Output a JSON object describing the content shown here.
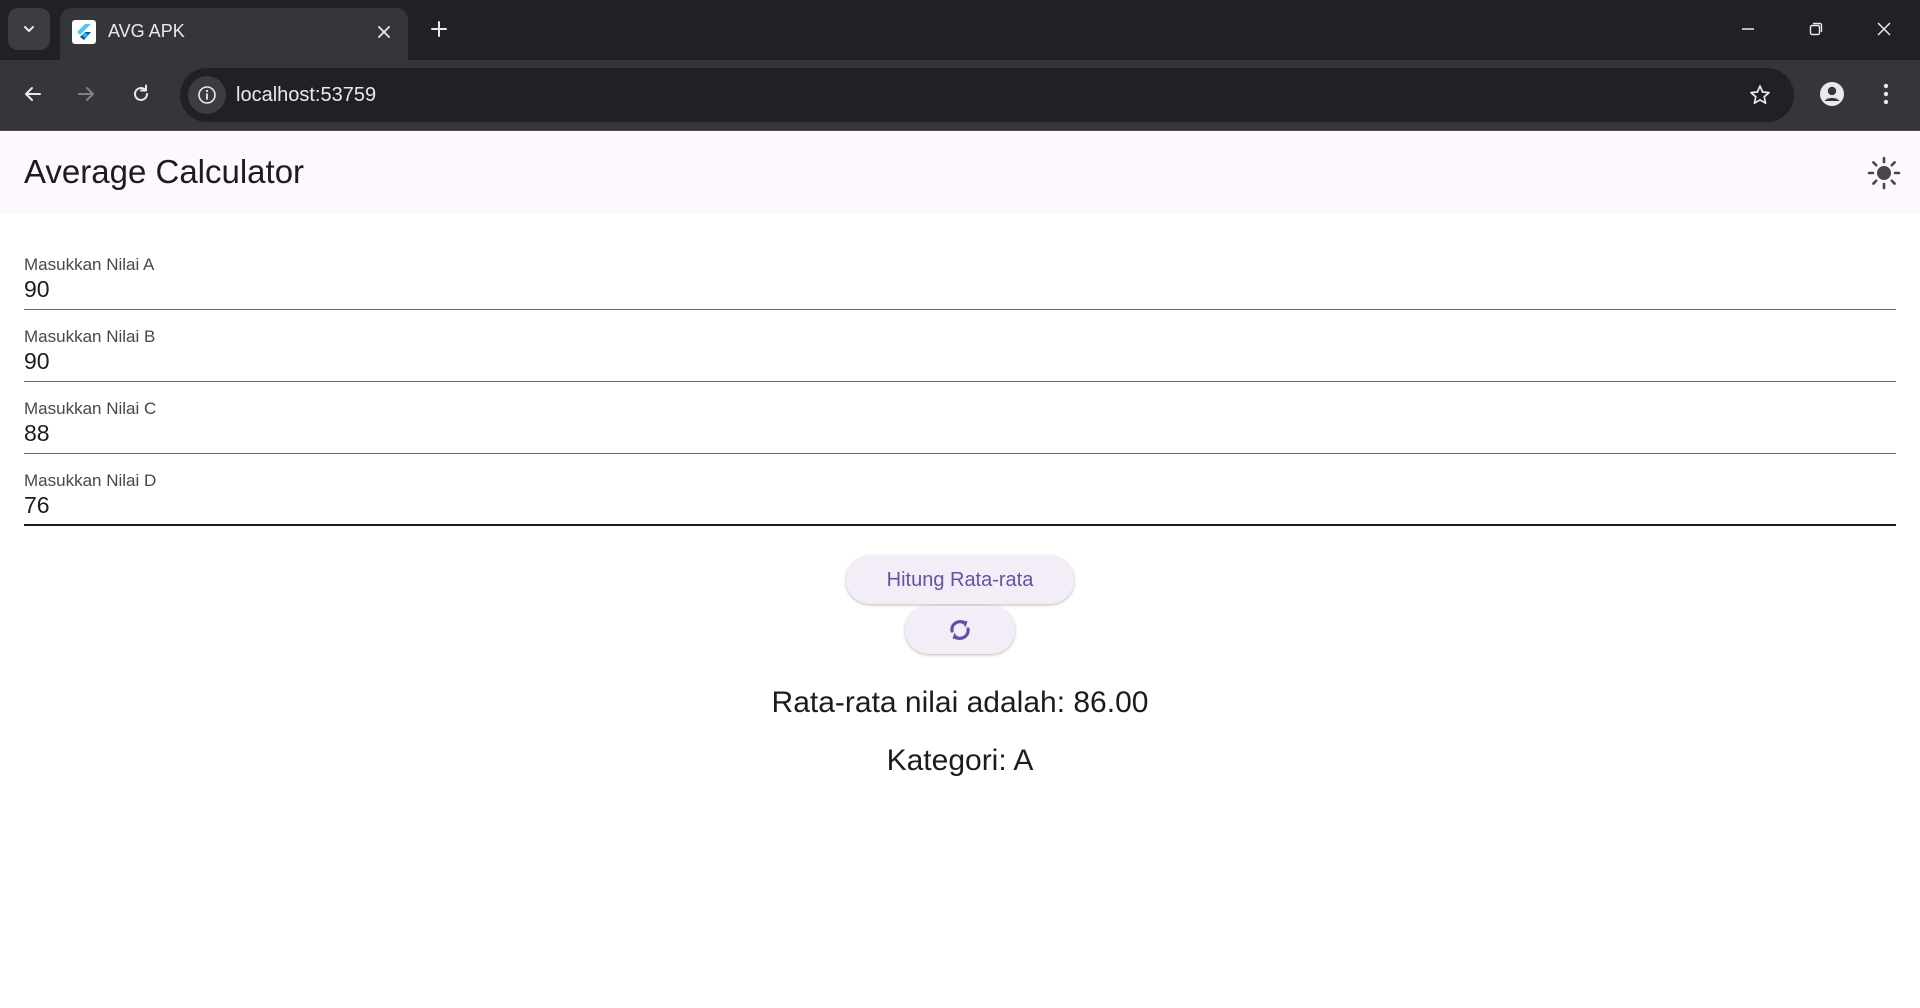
{
  "browser": {
    "tab": {
      "title": "AVG APK"
    },
    "address_bar": {
      "url": "localhost:53759"
    },
    "icons": {
      "tab_search": "chevron-down-icon",
      "favicon": "flutter-icon",
      "tab_close": "close-icon",
      "new_tab": "plus-icon",
      "minimize": "minimize-icon",
      "restore": "restore-icon",
      "window_close": "close-icon",
      "back": "arrow-left-icon",
      "forward": "arrow-right-icon",
      "reload": "reload-icon",
      "site_info": "info-icon",
      "bookmark": "star-icon",
      "profile": "profile-icon",
      "menu": "more-vertical-icon"
    }
  },
  "app": {
    "title": "Average Calculator",
    "theme_toggle_icon": "sun-icon",
    "fields": [
      {
        "label": "Masukkan Nilai A",
        "value": "90"
      },
      {
        "label": "Masukkan Nilai B",
        "value": "90"
      },
      {
        "label": "Masukkan Nilai C",
        "value": "88"
      },
      {
        "label": "Masukkan Nilai D",
        "value": "76"
      }
    ],
    "calculate_button": "Hitung Rata-rata",
    "reset_icon": "refresh-icon",
    "result": {
      "average_text": "Rata-rata nilai adalah: 86.00",
      "category_text": "Kategori: A"
    }
  },
  "colors": {
    "chrome_dark": "#202124",
    "chrome_toolbar": "#35363a",
    "appbar_bg": "#fdf7fe",
    "button_bg": "#f3edf7",
    "accent": "#6750a4",
    "text": "#1d1b20"
  }
}
